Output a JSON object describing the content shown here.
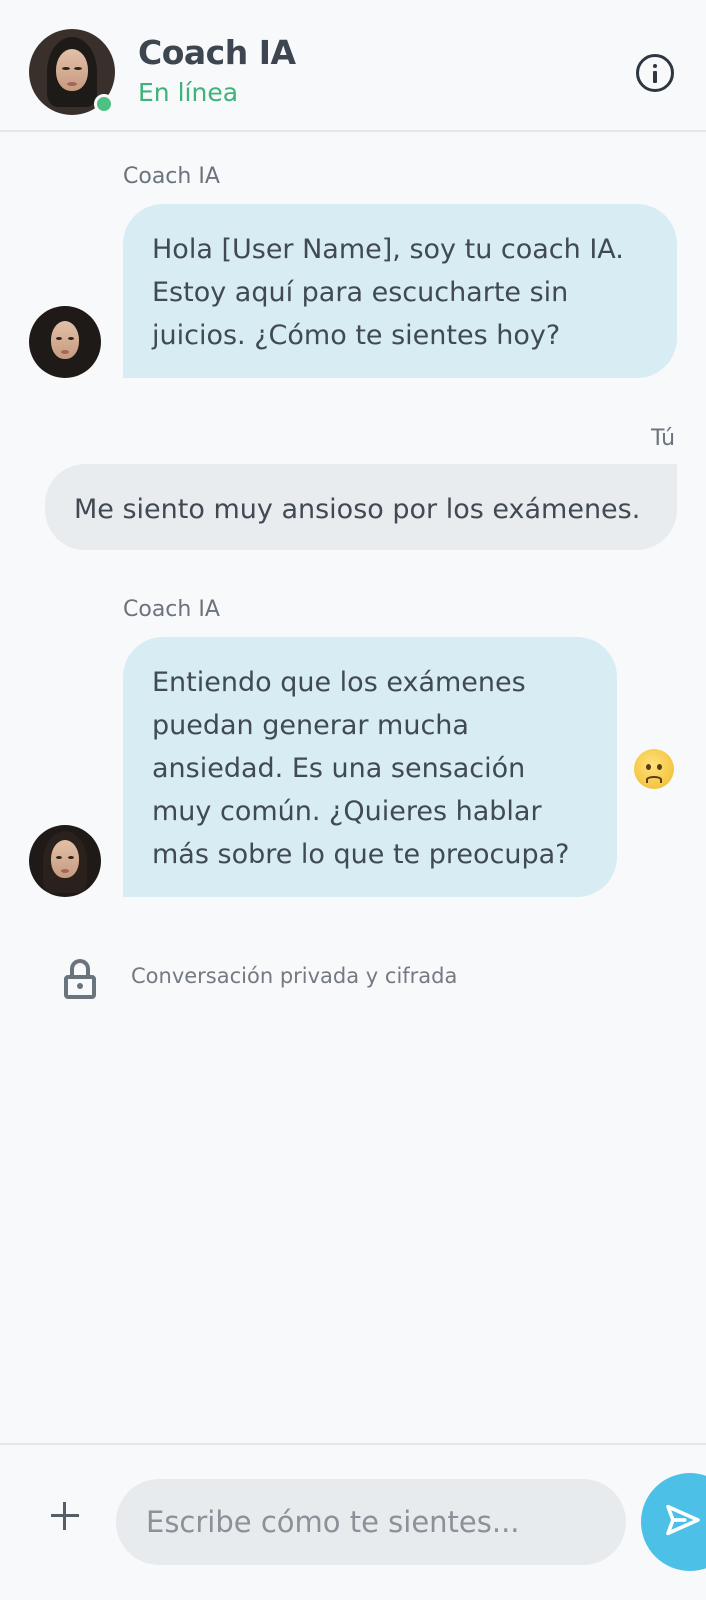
{
  "header": {
    "title": "Coach IA",
    "status": "En línea",
    "status_color": "#3fb27a"
  },
  "messages": [
    {
      "sender": "Coach IA",
      "text": "Hola [User Name], soy tu coach IA. Estoy aquí para escucharte sin juicios. ¿Cómo te sientes hoy?",
      "from": "coach"
    },
    {
      "sender": "Tú",
      "text": "Me siento muy ansioso por los exámenes.",
      "from": "user"
    },
    {
      "sender": "Coach IA",
      "text": "Entiendo que los exámenes puedan generar mucha ansiedad. Es una sensación muy común. ¿Quieres hablar más sobre lo que te preocupa?",
      "from": "coach",
      "reaction": "worried-face-emoji"
    }
  ],
  "privacy_note": "Conversación privada y cifrada",
  "composer": {
    "placeholder": "Escribe cómo te sientes..."
  },
  "colors": {
    "coach_bubble": "#d7ecf3",
    "user_bubble": "#e9ecee",
    "send_button": "#4cc0e6",
    "online": "#4fbf84"
  },
  "icons": {
    "info": "info-icon",
    "lock": "lock-icon",
    "add": "plus-icon",
    "send": "send-icon"
  }
}
